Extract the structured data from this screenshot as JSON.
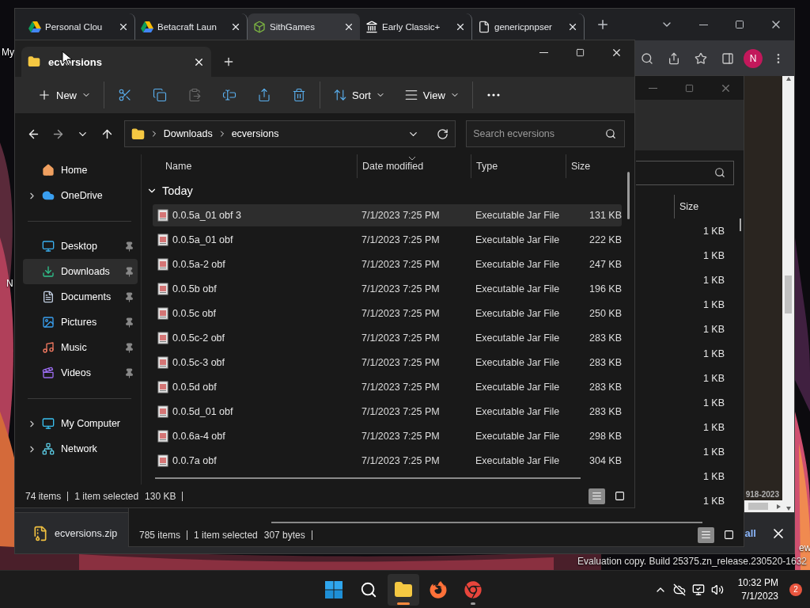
{
  "desktop": {
    "labels": [
      {
        "text": "My"
      },
      {
        "text": "N"
      },
      {
        "text": "ew"
      }
    ],
    "watermark": "Evaluation copy. Build 25375.zn_release.230520-1632"
  },
  "browser": {
    "tabs": [
      {
        "title": "Personal Clou",
        "kind": "drive",
        "selected": false
      },
      {
        "title": "Betacraft Laun",
        "kind": "drive",
        "selected": false
      },
      {
        "title": "SithGames",
        "kind": "cube",
        "selected": true
      },
      {
        "title": "Early Classic+",
        "kind": "museum",
        "selected": false
      },
      {
        "title": "genericpnpser",
        "kind": "file",
        "selected": false
      }
    ],
    "avatar": "N",
    "page_footer": "918-2023",
    "download": {
      "file": "ecversions.zip",
      "show_all": "all"
    }
  },
  "back_explorer": {
    "size_header": "Size",
    "sizes": [
      "1 KB",
      "1 KB",
      "1 KB",
      "1 KB",
      "1 KB",
      "1 KB",
      "1 KB",
      "1 KB",
      "1 KB",
      "1 KB",
      "1 KB",
      "1 KB"
    ],
    "status": {
      "count": "785 items",
      "selection": "1 item selected",
      "size": "307 bytes"
    },
    "views": [
      {
        "kind": "details",
        "selected": true
      },
      {
        "kind": "tiles",
        "selected": false
      }
    ]
  },
  "explorer": {
    "tab": "ecversions",
    "toolbar_groups": [
      [
        {
          "kind": "new",
          "label": "New",
          "disabled": false
        }
      ],
      [
        {
          "kind": "cut",
          "disabled": false
        },
        {
          "kind": "copy",
          "disabled": false
        },
        {
          "kind": "paste",
          "disabled": true
        },
        {
          "kind": "rename",
          "disabled": false
        },
        {
          "kind": "share",
          "disabled": false
        },
        {
          "kind": "delete",
          "disabled": false
        }
      ],
      [
        {
          "kind": "sort",
          "label": "Sort",
          "disabled": false
        },
        {
          "kind": "view",
          "label": "View",
          "disabled": false
        }
      ],
      [
        {
          "kind": "more",
          "disabled": false
        }
      ]
    ],
    "path": [
      "Downloads",
      "ecversions"
    ],
    "search_placeholder": "Search ecversions",
    "sidebar_sections": [
      [
        {
          "label": "Home",
          "kind": "home",
          "expandable": false,
          "pinned": false,
          "selected": false
        },
        {
          "label": "OneDrive",
          "kind": "cloud",
          "expandable": true,
          "pinned": false,
          "selected": false
        }
      ],
      [
        {
          "label": "Desktop",
          "kind": "desktop",
          "expandable": false,
          "pinned": true,
          "selected": false
        },
        {
          "label": "Downloads",
          "kind": "downloads",
          "expandable": false,
          "pinned": true,
          "selected": true
        },
        {
          "label": "Documents",
          "kind": "documents",
          "expandable": false,
          "pinned": true,
          "selected": false
        },
        {
          "label": "Pictures",
          "kind": "pictures",
          "expandable": false,
          "pinned": true,
          "selected": false
        },
        {
          "label": "Music",
          "kind": "music",
          "expandable": false,
          "pinned": true,
          "selected": false
        },
        {
          "label": "Videos",
          "kind": "videos",
          "expandable": false,
          "pinned": true,
          "selected": false
        }
      ],
      [
        {
          "label": "My Computer",
          "kind": "computer",
          "expandable": true,
          "pinned": false,
          "selected": false
        },
        {
          "label": "Network",
          "kind": "network",
          "expandable": true,
          "pinned": false,
          "selected": false
        }
      ]
    ],
    "columns": [
      "Name",
      "Date modified",
      "Type",
      "Size"
    ],
    "group": {
      "label": "Today",
      "expanded": true
    },
    "rows": [
      {
        "name": "0.0.5a_01 obf 3",
        "date": "7/1/2023 7:25 PM",
        "type": "Executable Jar File",
        "size": "131 KB",
        "selected": true
      },
      {
        "name": "0.0.5a_01 obf",
        "date": "7/1/2023 7:25 PM",
        "type": "Executable Jar File",
        "size": "222 KB",
        "selected": false
      },
      {
        "name": "0.0.5a-2 obf",
        "date": "7/1/2023 7:25 PM",
        "type": "Executable Jar File",
        "size": "247 KB",
        "selected": false
      },
      {
        "name": "0.0.5b obf",
        "date": "7/1/2023 7:25 PM",
        "type": "Executable Jar File",
        "size": "196 KB",
        "selected": false
      },
      {
        "name": "0.0.5c obf",
        "date": "7/1/2023 7:25 PM",
        "type": "Executable Jar File",
        "size": "250 KB",
        "selected": false
      },
      {
        "name": "0.0.5c-2 obf",
        "date": "7/1/2023 7:25 PM",
        "type": "Executable Jar File",
        "size": "283 KB",
        "selected": false
      },
      {
        "name": "0.0.5c-3 obf",
        "date": "7/1/2023 7:25 PM",
        "type": "Executable Jar File",
        "size": "283 KB",
        "selected": false
      },
      {
        "name": "0.0.5d obf",
        "date": "7/1/2023 7:25 PM",
        "type": "Executable Jar File",
        "size": "283 KB",
        "selected": false
      },
      {
        "name": "0.0.5d_01 obf",
        "date": "7/1/2023 7:25 PM",
        "type": "Executable Jar File",
        "size": "283 KB",
        "selected": false
      },
      {
        "name": "0.0.6a-4 obf",
        "date": "7/1/2023 7:25 PM",
        "type": "Executable Jar File",
        "size": "298 KB",
        "selected": false
      },
      {
        "name": "0.0.7a obf",
        "date": "7/1/2023 7:25 PM",
        "type": "Executable Jar File",
        "size": "304 KB",
        "selected": false
      }
    ],
    "status": {
      "count": "74 items",
      "selection": "1 item selected",
      "size": "130 KB"
    },
    "views": [
      {
        "kind": "details",
        "selected": true
      },
      {
        "kind": "tiles",
        "selected": false
      }
    ]
  },
  "taskbar": {
    "apps": [
      {
        "kind": "start",
        "running": false,
        "active": false
      },
      {
        "kind": "search",
        "running": false,
        "active": false
      },
      {
        "kind": "explorer",
        "running": true,
        "active": true
      },
      {
        "kind": "firefox",
        "running": false,
        "active": false
      },
      {
        "kind": "chrome",
        "running": true,
        "active": false
      }
    ],
    "time": "10:32 PM",
    "date": "7/1/2023",
    "notifications": "2"
  }
}
